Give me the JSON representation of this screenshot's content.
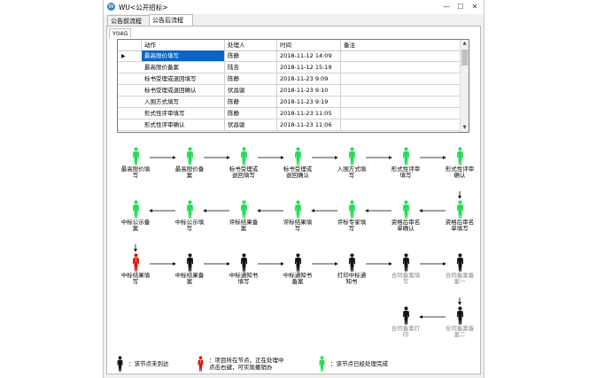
{
  "window": {
    "title": "WU<公开招标>",
    "min": "—",
    "max": "☐",
    "close": "✕"
  },
  "tabs": [
    {
      "label": "公告前流程"
    },
    {
      "label": "公告后流程"
    }
  ],
  "subtab": "Y04G",
  "grid": {
    "columns": [
      "动作",
      "处理人",
      "时间",
      "备注"
    ],
    "rows": [
      [
        "最高限价填写",
        "陈静",
        "2018-11-12 14:09",
        ""
      ],
      [
        "最高限价备案",
        "陆吉",
        "2018-11-12 15:19",
        ""
      ],
      [
        "标书受理或退回填写",
        "陈静",
        "2018-11-23 9:09",
        ""
      ],
      [
        "标书受理或退回确认",
        "伏昌骏",
        "2018-11-23 9:10",
        ""
      ],
      [
        "入围方式填写",
        "陈静",
        "2018-11-23 9:19",
        ""
      ],
      [
        "形式性评审填写",
        "陈静",
        "2018-11-23 11:05",
        ""
      ],
      [
        "形式性评审确认",
        "伏昌骏",
        "2018-11-23 11:06",
        ""
      ]
    ]
  },
  "colors": {
    "done": "#22dd55",
    "current": "#dd1111",
    "pending": "#111111",
    "selected": "#0a64c8"
  },
  "flow": {
    "row1": [
      {
        "label": [
          "最高限价填",
          "写"
        ],
        "state": "done"
      },
      {
        "label": [
          "最高限价备",
          "案"
        ],
        "state": "done"
      },
      {
        "label": [
          "标书受理或",
          "退回填写"
        ],
        "state": "done"
      },
      {
        "label": [
          "标书受理或",
          "退回确认"
        ],
        "state": "done"
      },
      {
        "label": [
          "入围方式填",
          "写"
        ],
        "state": "done"
      },
      {
        "label": [
          "形式性评审",
          "填写"
        ],
        "state": "done"
      },
      {
        "label": [
          "形式性评审",
          "确认"
        ],
        "state": "done"
      }
    ],
    "row2": [
      {
        "label": [
          "中标公示备",
          "案"
        ],
        "state": "done"
      },
      {
        "label": [
          "中标公示填",
          "写"
        ],
        "state": "done"
      },
      {
        "label": [
          "评标结果备",
          "案"
        ],
        "state": "done"
      },
      {
        "label": [
          "评标结果填",
          "写"
        ],
        "state": "done"
      },
      {
        "label": [
          "评标专家填",
          "写"
        ],
        "state": "done"
      },
      {
        "label": [
          "资格后审名",
          "单确认"
        ],
        "state": "done"
      },
      {
        "label": [
          "资格后审名",
          "单填写"
        ],
        "state": "done"
      }
    ],
    "row3": [
      {
        "label": [
          "中标结果填",
          "写"
        ],
        "state": "current"
      },
      {
        "label": [
          "中标结果备",
          "案"
        ],
        "state": "pending"
      },
      {
        "label": [
          "中标通知书",
          "填写"
        ],
        "state": "pending"
      },
      {
        "label": [
          "中标通知书",
          "备案"
        ],
        "state": "pending"
      },
      {
        "label": [
          "打印中标通",
          "知书"
        ],
        "state": "pending"
      },
      {
        "label": [
          "合同备案填",
          "写"
        ],
        "state": "pending",
        "gray": true
      },
      {
        "label": [
          "合同备案备",
          "案一"
        ],
        "state": "pending",
        "gray": true
      }
    ],
    "row4": [
      {
        "label": [
          "合同备案打",
          "印"
        ],
        "state": "pending",
        "gray": true
      },
      {
        "label": [
          "合同备案备",
          "案二"
        ],
        "state": "pending",
        "gray": true
      }
    ]
  },
  "legend": [
    {
      "state": "pending",
      "text": [
        "：该节点未到达"
      ]
    },
    {
      "state": "current",
      "text": [
        "：项目所在节点，正在处理中",
        "点击右键，可实现撤销办"
      ]
    },
    {
      "state": "done",
      "text": [
        "：该节点已经处理完成"
      ]
    }
  ]
}
